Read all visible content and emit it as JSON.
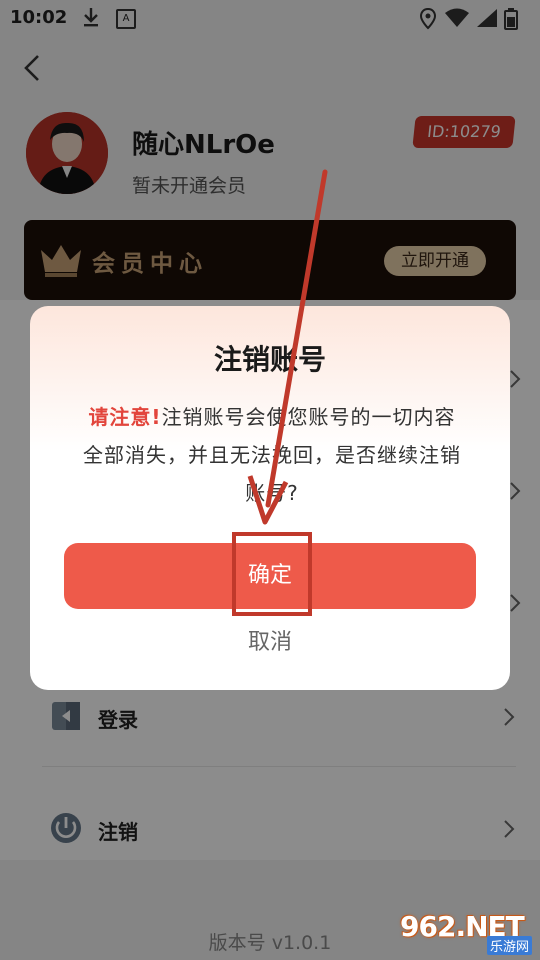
{
  "status_bar": {
    "time": "10:02",
    "a_icon": "A"
  },
  "profile": {
    "username": "随心NLrOe",
    "member_status": "暂未开通会员",
    "user_id": "ID:10279"
  },
  "vip": {
    "title": "会员中心",
    "open_button": "立即开通"
  },
  "menu": {
    "items": [
      {
        "label": "登录",
        "icon": "login-icon"
      },
      {
        "label": "注销",
        "icon": "power-icon"
      }
    ]
  },
  "version": "版本号 v1.0.1",
  "dialog": {
    "title": "注销账号",
    "warning_prefix": "请注意!",
    "message": "注销账号会使您账号的一切内容全部消失，并且无法挽回，是否继续注销账号?",
    "confirm": "确定",
    "cancel": "取消"
  },
  "watermark": {
    "main": "962.NET",
    "sub": "乐游网"
  },
  "colors": {
    "accent_red": "#ee5a4a",
    "id_badge": "#c8352b",
    "vip_gold": "#c9a377",
    "vip_bg": "#1d0f08"
  }
}
